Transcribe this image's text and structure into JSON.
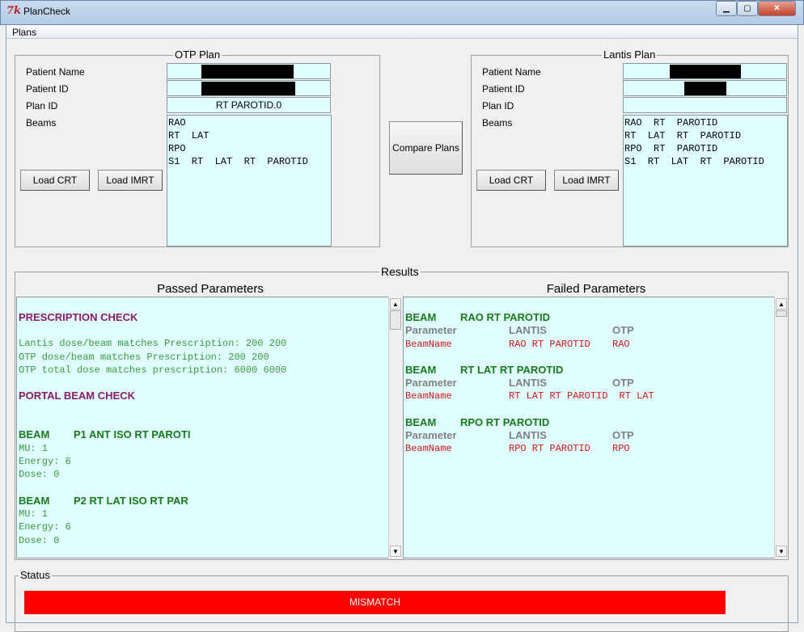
{
  "window": {
    "title": "PlanCheck",
    "icon": "tk-feather-icon"
  },
  "menu": {
    "plans": "Plans"
  },
  "otp": {
    "title": "OTP Plan",
    "labels": {
      "name": "Patient Name",
      "id": "Patient ID",
      "plan": "Plan ID",
      "beams": "Beams"
    },
    "plan_id": "RT PAROTID.0",
    "beams": [
      "RAO",
      "RT  LAT",
      "RPO",
      "S1  RT  LAT  RT  PAROTID"
    ],
    "load_crt": "Load CRT",
    "load_imrt": "Load IMRT"
  },
  "lantis": {
    "title": "Lantis Plan",
    "labels": {
      "name": "Patient Name",
      "id": "Patient ID",
      "plan": "Plan ID",
      "beams": "Beams"
    },
    "plan_id": "",
    "beams": [
      "RAO  RT  PAROTID",
      "RT  LAT  RT  PAROTID",
      "RPO  RT  PAROTID",
      "S1  RT  LAT  RT  PAROTID"
    ],
    "load_crt": "Load CRT",
    "load_imrt": "Load IMRT"
  },
  "compare": "Compare Plans",
  "results": {
    "title": "Results",
    "passed_title": "Passed Parameters",
    "failed_title": "Failed Parameters",
    "passed": {
      "prescription_heading": "PRESCRIPTION CHECK",
      "prescription_lines": [
        "Lantis dose/beam matches Prescription: 200 200",
        "OTP dose/beam matches Prescription: 200 200",
        "OTP total dose matches prescription: 6000 6000"
      ],
      "portal_heading": "PORTAL BEAM CHECK",
      "beams": [
        {
          "label": "BEAM",
          "name": "P1 ANT ISO RT PAROTI",
          "lines": [
            "MU: 1",
            "Energy: 6",
            "Dose: 0"
          ]
        },
        {
          "label": "BEAM",
          "name": "P2 RT LAT ISO RT PAR",
          "lines": [
            "MU: 1",
            "Energy: 6",
            "Dose: 0"
          ]
        }
      ]
    },
    "failed": {
      "beams": [
        {
          "label": "BEAM",
          "name": "RAO RT PAROTID",
          "headers": [
            "Parameter",
            "LANTIS",
            "OTP"
          ],
          "row": [
            "BeamName",
            "RAO RT PAROTID",
            "RAO"
          ]
        },
        {
          "label": "BEAM",
          "name": "RT LAT RT PAROTID",
          "headers": [
            "Parameter",
            "LANTIS",
            "OTP"
          ],
          "row": [
            "BeamName",
            "RT LAT RT PAROTID",
            "RT LAT"
          ]
        },
        {
          "label": "BEAM",
          "name": "RPO RT PAROTID",
          "headers": [
            "Parameter",
            "LANTIS",
            "OTP"
          ],
          "row": [
            "BeamName",
            "RPO RT PAROTID",
            "RPO"
          ]
        }
      ]
    }
  },
  "status": {
    "title": "Status",
    "value": "MISMATCH",
    "color": "#ff0000"
  }
}
